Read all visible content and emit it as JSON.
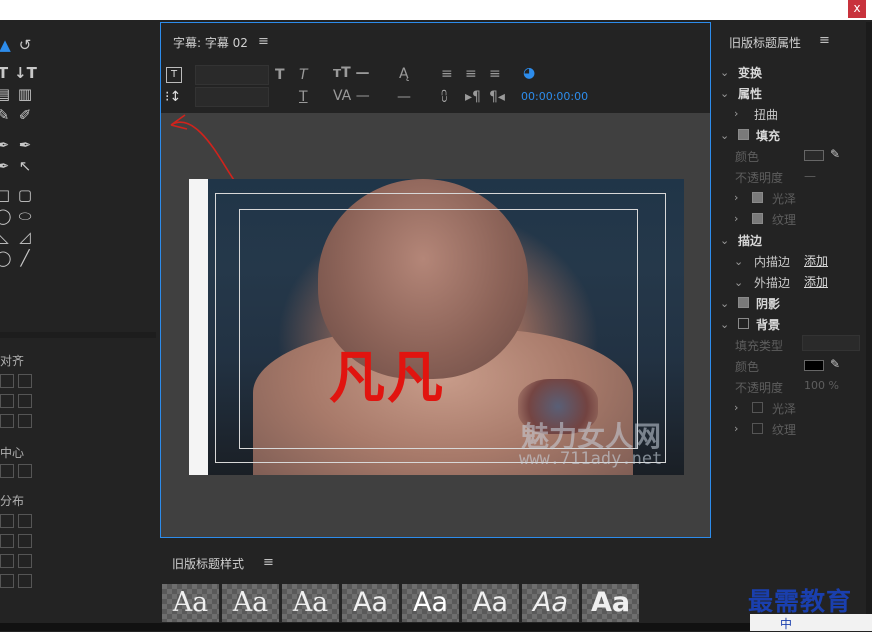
{
  "window": {
    "close_label": "x"
  },
  "left_panel": {
    "align_label": "对齐",
    "center_label": "中心",
    "distribute_label": "分布"
  },
  "title_panel": {
    "title": "字幕: 字幕 02",
    "timecode": "00:00:00:00",
    "caption_text": "凡凡",
    "watermark_text": "魅力女人网",
    "watermark_url": "www.711ady.net"
  },
  "styles_panel": {
    "title": "旧版标题样式",
    "swatches": [
      "Aa",
      "Aa",
      "Aa",
      "Aa",
      "Aa",
      "Aa",
      "Aa",
      "Aa"
    ]
  },
  "properties_panel": {
    "title": "旧版标题属性",
    "transform": "变换",
    "attributes": "属性",
    "distort": "扭曲",
    "fill": "填充",
    "color": "颜色",
    "opacity": "不透明度",
    "opacity_value": "—",
    "sheen": "光泽",
    "texture": "纹理",
    "strokes": "描边",
    "inner_stroke": "内描边",
    "outer_stroke": "外描边",
    "add": "添加",
    "shadow": "阴影",
    "background": "背景",
    "fill_type": "填充类型",
    "bg_color": "颜色",
    "bg_opacity": "不透明度",
    "bg_opacity_value": "100 %",
    "bg_sheen": "光泽",
    "bg_texture": "纹理"
  },
  "branding": {
    "text": "最需教育",
    "taskbar_text": "中"
  },
  "colors": {
    "accent": "#2d8ceb",
    "caption": "#e1140f",
    "brand": "#1a3fae"
  }
}
